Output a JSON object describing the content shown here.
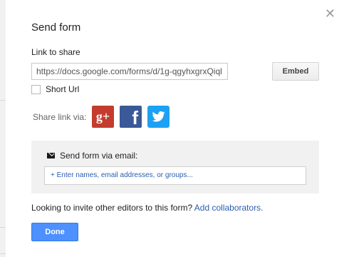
{
  "dialog": {
    "title": "Send form",
    "close_icon": "close-icon",
    "link_label": "Link to share",
    "link_value": "https://docs.google.com/forms/d/1g-qgyhxgrxQiql",
    "embed_label": "Embed",
    "short_url_label": "Short Url",
    "short_url_checked": false,
    "share_label": "Share link via:",
    "share_icons": {
      "google_plus": {
        "icon": "google-plus-icon",
        "glyph": "g+",
        "color": "#c33c2e"
      },
      "facebook": {
        "icon": "facebook-icon",
        "glyph": "f",
        "color": "#3b5998"
      },
      "twitter": {
        "icon": "twitter-icon",
        "color": "#1da1f2"
      }
    },
    "email": {
      "label": "Send form via email:",
      "icon": "envelope-icon",
      "placeholder": "+ Enter names, email addresses, or groups..."
    },
    "invite": {
      "text": "Looking to invite other editors to this form?",
      "link": "Add collaborators."
    },
    "done_label": "Done"
  },
  "colors": {
    "primary_button": "#4d90fe",
    "link": "#2a5db0",
    "panel_background": "#f1f1f1"
  }
}
